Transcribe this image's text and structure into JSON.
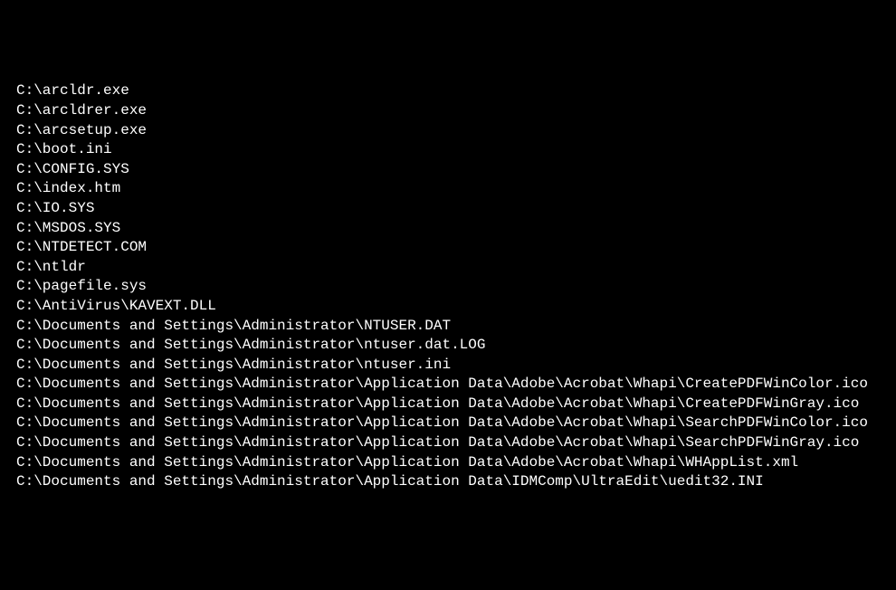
{
  "terminal": {
    "lines": [
      "C:\\arcldr.exe",
      "C:\\arcldrer.exe",
      "C:\\arcsetup.exe",
      "C:\\boot.ini",
      "C:\\CONFIG.SYS",
      "C:\\index.htm",
      "C:\\IO.SYS",
      "C:\\MSDOS.SYS",
      "C:\\NTDETECT.COM",
      "C:\\ntldr",
      "C:\\pagefile.sys",
      "C:\\AntiVirus\\KAVEXT.DLL",
      "C:\\Documents and Settings\\Administrator\\NTUSER.DAT",
      "C:\\Documents and Settings\\Administrator\\ntuser.dat.LOG",
      "C:\\Documents and Settings\\Administrator\\ntuser.ini",
      "C:\\Documents and Settings\\Administrator\\Application Data\\Adobe\\Acrobat\\Whapi\\CreatePDFWinColor.ico",
      "C:\\Documents and Settings\\Administrator\\Application Data\\Adobe\\Acrobat\\Whapi\\CreatePDFWinGray.ico",
      "C:\\Documents and Settings\\Administrator\\Application Data\\Adobe\\Acrobat\\Whapi\\SearchPDFWinColor.ico",
      "C:\\Documents and Settings\\Administrator\\Application Data\\Adobe\\Acrobat\\Whapi\\SearchPDFWinGray.ico",
      "C:\\Documents and Settings\\Administrator\\Application Data\\Adobe\\Acrobat\\Whapi\\WHAppList.xml",
      "C:\\Documents and Settings\\Administrator\\Application Data\\IDMComp\\UltraEdit\\uedit32.INI"
    ]
  }
}
